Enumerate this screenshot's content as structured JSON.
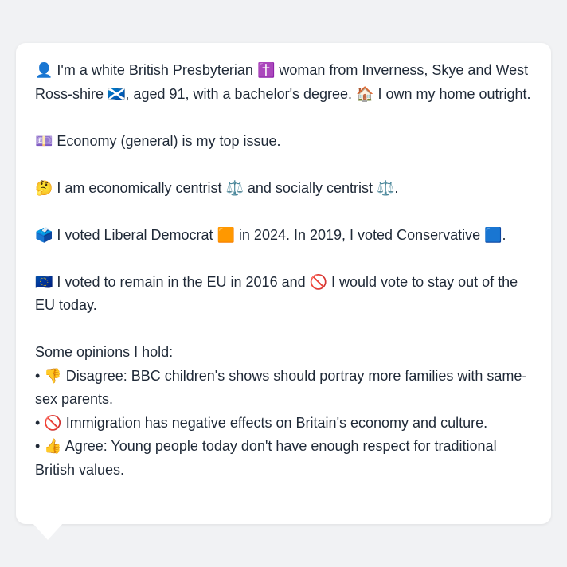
{
  "message": {
    "identity": "👤 I'm a white British Presbyterian ✝️ woman from Inverness, Skye and West Ross-shire 🏴󠁧󠁢󠁳󠁣󠁴󠁿, aged 91, with a bachelor's degree. 🏠 I own my home outright.",
    "top_issue": "💷 Economy (general) is my top issue.",
    "ideology": "🤔 I am economically centrist ⚖️ and socially centrist ⚖️.",
    "votes": "🗳️ I voted Liberal Democrat 🟧 in 2024. In 2019, I voted Conservative 🟦.",
    "eu": "🇪🇺 I voted to remain in the EU in 2016 and 🚫 I would vote to stay out of the EU today.",
    "opinions_heading": "Some opinions I hold:",
    "opinions": [
      "• 👎 Disagree: BBC children's shows should portray more families with same-sex parents.",
      "• 🚫 Immigration has negative effects on Britain's economy and culture.",
      "• 👍 Agree: Young people today don't have enough respect for traditional British values."
    ]
  }
}
